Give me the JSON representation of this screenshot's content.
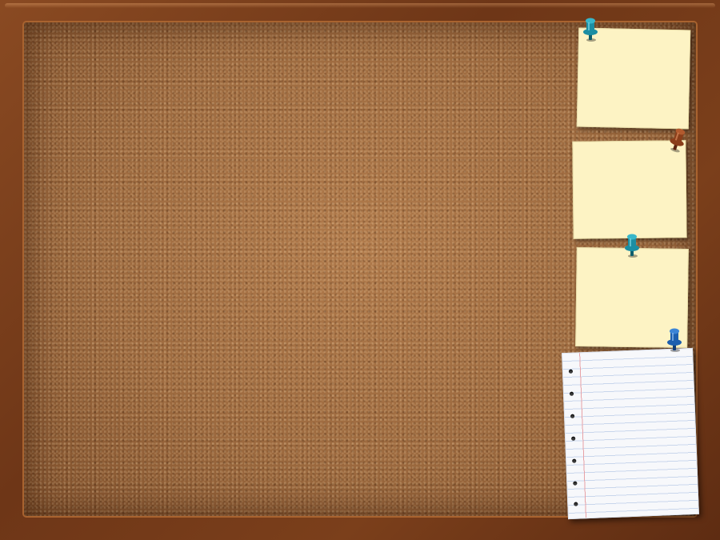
{
  "scene": {
    "frame_color": "#7b3f1b",
    "cork_color": "#a36e42",
    "sticky_note_color": "#fdf3c4",
    "lined_paper_color": "#f7f8fb"
  },
  "notes": [
    {
      "name": "sticky-note-1",
      "text": ""
    },
    {
      "name": "sticky-note-2",
      "text": ""
    },
    {
      "name": "sticky-note-3",
      "text": ""
    },
    {
      "name": "lined-paper-note",
      "text": ""
    }
  ],
  "pins": [
    {
      "name": "pushpin-teal-icon",
      "color": "#1b8ea3"
    },
    {
      "name": "pushpin-brown-icon",
      "color": "#8a3e1a"
    },
    {
      "name": "pushpin-teal-icon",
      "color": "#1b8ea3"
    },
    {
      "name": "pushpin-blue-icon",
      "color": "#1d5fae"
    }
  ]
}
